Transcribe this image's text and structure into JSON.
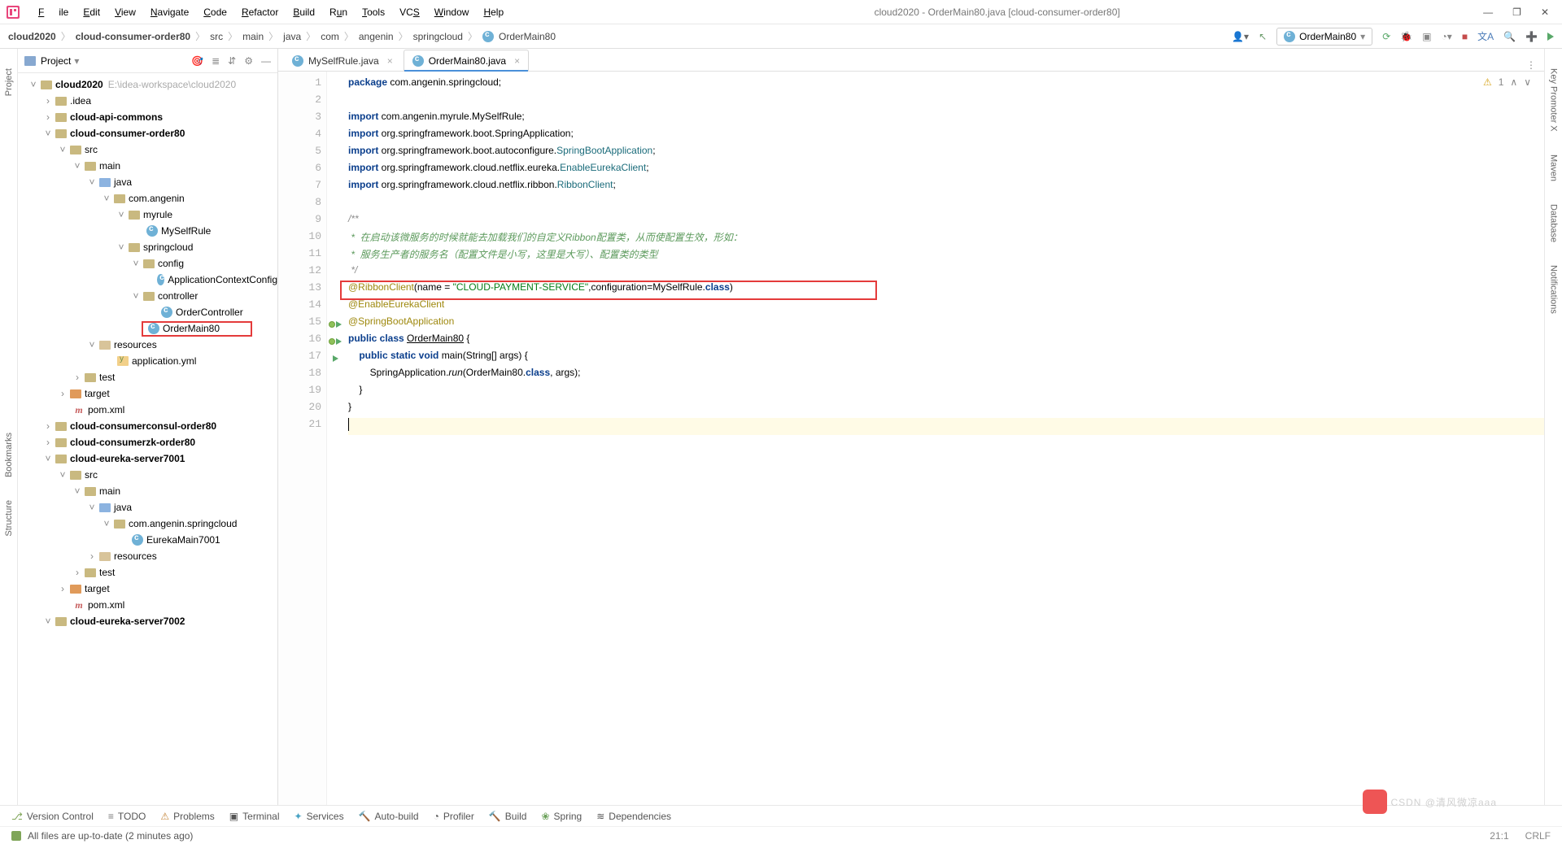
{
  "menu": [
    "File",
    "Edit",
    "View",
    "Navigate",
    "Code",
    "Refactor",
    "Build",
    "Run",
    "Tools",
    "VCS",
    "Window",
    "Help"
  ],
  "title": "cloud2020 - OrderMain80.java [cloud-consumer-order80]",
  "breadcrumb": [
    "cloud2020",
    "cloud-consumer-order80",
    "src",
    "main",
    "java",
    "com",
    "angenin",
    "springcloud",
    "OrderMain80"
  ],
  "run_config": "OrderMain80",
  "project_panel_title": "Project",
  "tree": {
    "root": "cloud2020",
    "root_hint": "E:\\idea-workspace\\cloud2020",
    "items": [
      ".idea",
      "cloud-api-commons",
      "cloud-consumer-order80",
      "src",
      "main",
      "java",
      "com.angenin",
      "myrule",
      "MySelfRule",
      "springcloud",
      "config",
      "ApplicationContextConfig",
      "controller",
      "OrderController",
      "OrderMain80",
      "resources",
      "application.yml",
      "test",
      "target",
      "pom.xml",
      "cloud-consumerconsul-order80",
      "cloud-consumerzk-order80",
      "cloud-eureka-server7001",
      "src2",
      "main2",
      "java2",
      "com.angenin.springcloud",
      "EurekaMain7001",
      "resources2",
      "test2",
      "target2",
      "pom2",
      "cloud-eureka-server7002"
    ],
    "src2_label": "src",
    "main2_label": "main",
    "java2_label": "java",
    "resources2_label": "resources",
    "test2_label": "test",
    "target2_label": "target",
    "pom2_label": "pom.xml"
  },
  "tabs": [
    {
      "label": "MySelfRule.java"
    },
    {
      "label": "OrderMain80.java",
      "active": true
    }
  ],
  "inspection": {
    "warn_count": "1"
  },
  "code_lines": 21,
  "code": {
    "l1_pkg": "package ",
    "l1_rest": "com.angenin.springcloud;",
    "l3_imp": "import ",
    "l3_rest": "com.angenin.myrule.MySelfRule;",
    "l4_rest": "org.springframework.boot.SpringApplication;",
    "l5a": "org.springframework.boot.autoconfigure.",
    "l5b": "SpringBootApplication",
    "l5c": ";",
    "l6a": "org.springframework.cloud.netflix.eureka.",
    "l6b": "EnableEurekaClient",
    "l6c": ";",
    "l7a": "org.springframework.cloud.netflix.ribbon.",
    "l7b": "RibbonClient",
    "l7c": ";",
    "l9": "/**",
    "l10": " *  在启动该微服务的时候就能去加载我们的自定义Ribbon配置类，从而使配置生效，形如：",
    "l11": " *  服务生产者的服务名（配置文件是小写，这里是大写）、配置类的类型",
    "l12": " */",
    "l13_ann": "@RibbonClient",
    "l13_open": "(name = ",
    "l13_str": "\"CLOUD-PAYMENT-SERVICE\"",
    "l13_mid": ",configuration=MySelfRule.",
    "l13_cls": "class",
    "l13_close": ")",
    "l14": "@EnableEurekaClient",
    "l15": "@SpringBootApplication",
    "l16_a": "public class ",
    "l16_b": "OrderMain80",
    "l16_c": " {",
    "l17_a": "    public static void ",
    "l17_b": "main",
    "l17_c": "(String[] args) {",
    "l18_a": "        SpringApplication.",
    "l18_b": "run",
    "l18_c": "(OrderMain80.",
    "l18_d": "class",
    "l18_e": ", args);",
    "l19": "    }",
    "l20": "}",
    "l21": ""
  },
  "bottom_tools": [
    "Version Control",
    "TODO",
    "Problems",
    "Terminal",
    "Services",
    "Auto-build",
    "Profiler",
    "Build",
    "Spring",
    "Dependencies"
  ],
  "status_msg": "All files are up-to-date (2 minutes ago)",
  "status_right": {
    "pos": "21:1",
    "enc": "CRLF",
    "watermark": "CSDN @清风微凉aaa"
  },
  "right_rails": [
    "Key Promoter X",
    "Maven",
    "Database",
    "Notifications"
  ],
  "left_rails": [
    "Project",
    "Bookmarks",
    "Structure"
  ]
}
